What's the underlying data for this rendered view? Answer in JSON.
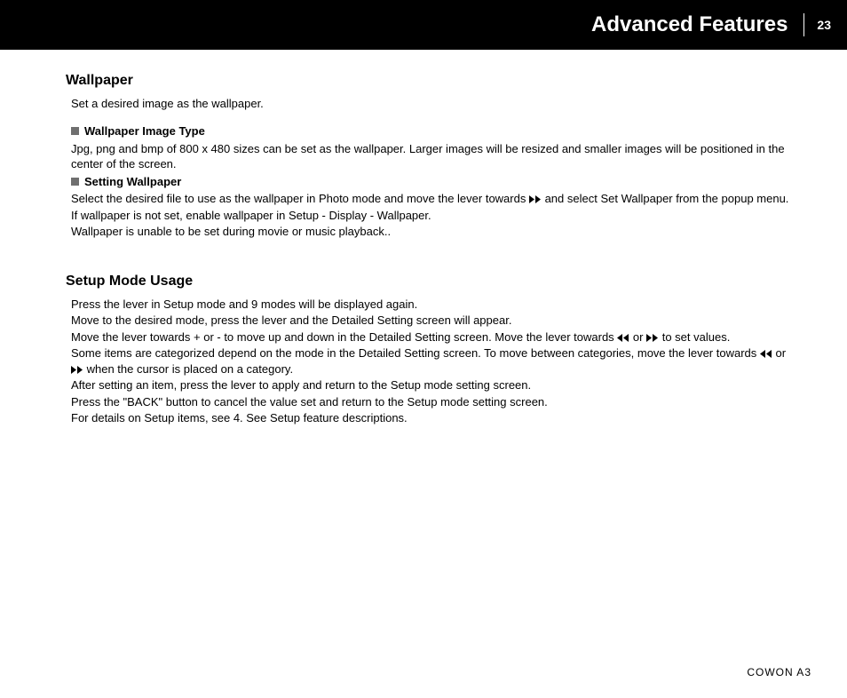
{
  "header": {
    "title": "Advanced Features",
    "page_number": "23"
  },
  "wallpaper": {
    "heading": "Wallpaper",
    "intro": "Set a desired image as the wallpaper.",
    "sub1_heading": "Wallpaper Image Type",
    "sub1_body": "Jpg, png and bmp of 800 x 480 sizes can be set as the wallpaper. Larger images will be resized and smaller images will be positioned in the center of the screen.",
    "sub2_heading": "Setting Wallpaper",
    "sub2_line1a": "Select the desired file to use as the wallpaper in Photo mode and move the lever towards ",
    "sub2_line1b": " and select Set Wallpaper from the popup menu.",
    "sub2_line2": "If wallpaper is not set, enable wallpaper in Setup - Display - Wallpaper.",
    "sub2_line3": "Wallpaper is unable to be set during movie or music playback.."
  },
  "setup": {
    "heading": "Setup Mode Usage",
    "line1": "Press the lever in Setup mode and 9 modes will be displayed again.",
    "line2": "Move to the desired mode, press the lever and the Detailed Setting screen will appear.",
    "line3a": "Move the lever towards + or - to move up and down in the Detailed Setting screen. Move the lever towards ",
    "line3_or": " or ",
    "line3b": " to set values.",
    "line4a": "Some items are categorized depend on the mode in the Detailed Setting screen. To move between categories, move the lever towards ",
    "line4_or": " or ",
    "line4b": " when the cursor is placed on a category.",
    "line5": "After setting an item, press the lever to apply and return to the Setup mode setting screen.",
    "line6": "Press the \"BACK\" button to cancel the value set and return to the Setup mode setting screen.",
    "line7": "For details on Setup items, see 4. See Setup feature descriptions."
  },
  "footer": "COWON A3"
}
